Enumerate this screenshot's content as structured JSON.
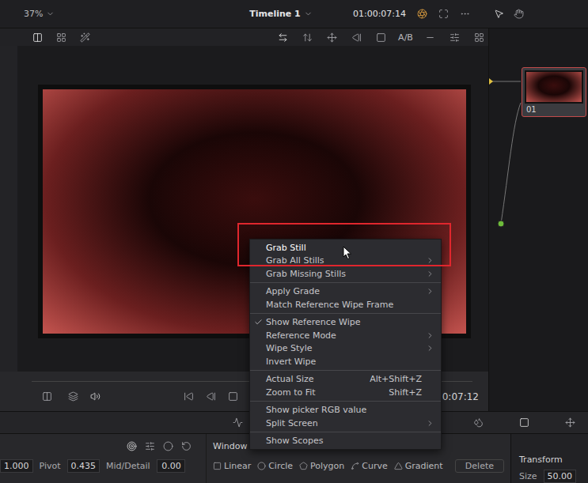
{
  "viewer": {
    "zoom": "37%",
    "timeline": "Timeline 1",
    "timecode": "01:00:07:14",
    "ab_label": "A/B",
    "transport_timecode": "0:07:12"
  },
  "node": {
    "label": "01"
  },
  "context_menu": {
    "items": [
      {
        "label": "Grab Still",
        "shortcut": "",
        "submenu": false,
        "checked": false,
        "highlighted": true,
        "separator_before": false
      },
      {
        "label": "Grab All Stills",
        "shortcut": "",
        "submenu": true,
        "checked": false,
        "highlighted": false,
        "separator_before": false
      },
      {
        "label": "Grab Missing Stills",
        "shortcut": "",
        "submenu": true,
        "checked": false,
        "highlighted": false,
        "separator_before": false
      },
      {
        "label": "Apply Grade",
        "shortcut": "",
        "submenu": true,
        "checked": false,
        "highlighted": false,
        "separator_before": true
      },
      {
        "label": "Match Reference Wipe Frame",
        "shortcut": "",
        "submenu": false,
        "checked": false,
        "highlighted": false,
        "separator_before": false
      },
      {
        "label": "Show Reference Wipe",
        "shortcut": "",
        "submenu": false,
        "checked": true,
        "highlighted": false,
        "separator_before": true
      },
      {
        "label": "Reference Mode",
        "shortcut": "",
        "submenu": true,
        "checked": false,
        "highlighted": false,
        "separator_before": false
      },
      {
        "label": "Wipe Style",
        "shortcut": "",
        "submenu": true,
        "checked": false,
        "highlighted": false,
        "separator_before": false
      },
      {
        "label": "Invert Wipe",
        "shortcut": "",
        "submenu": false,
        "checked": false,
        "highlighted": false,
        "separator_before": false
      },
      {
        "label": "Actual Size",
        "shortcut": "Alt+Shift+Z",
        "submenu": false,
        "checked": false,
        "highlighted": false,
        "separator_before": true
      },
      {
        "label": "Zoom to Fit",
        "shortcut": "Shift+Z",
        "submenu": false,
        "checked": false,
        "highlighted": false,
        "separator_before": false
      },
      {
        "label": "Show picker RGB value",
        "shortcut": "",
        "submenu": false,
        "checked": false,
        "highlighted": false,
        "separator_before": true
      },
      {
        "label": "Split Screen",
        "shortcut": "",
        "submenu": true,
        "checked": false,
        "highlighted": false,
        "separator_before": false
      },
      {
        "label": "Show Scopes",
        "shortcut": "",
        "submenu": false,
        "checked": false,
        "highlighted": false,
        "separator_before": true
      }
    ]
  },
  "primaries": [
    {
      "label": "",
      "value": "1.000"
    },
    {
      "label": "Pivot",
      "value": "0.435"
    },
    {
      "label": "Mid/Detail",
      "value": "0.00"
    }
  ],
  "window_panel": {
    "title": "Window",
    "tools": [
      "Linear",
      "Circle",
      "Polygon",
      "Curve",
      "Gradient"
    ],
    "delete": "Delete"
  },
  "transform": {
    "title": "Transform",
    "fields": [
      {
        "label": "Size",
        "value": "50.00"
      }
    ]
  }
}
